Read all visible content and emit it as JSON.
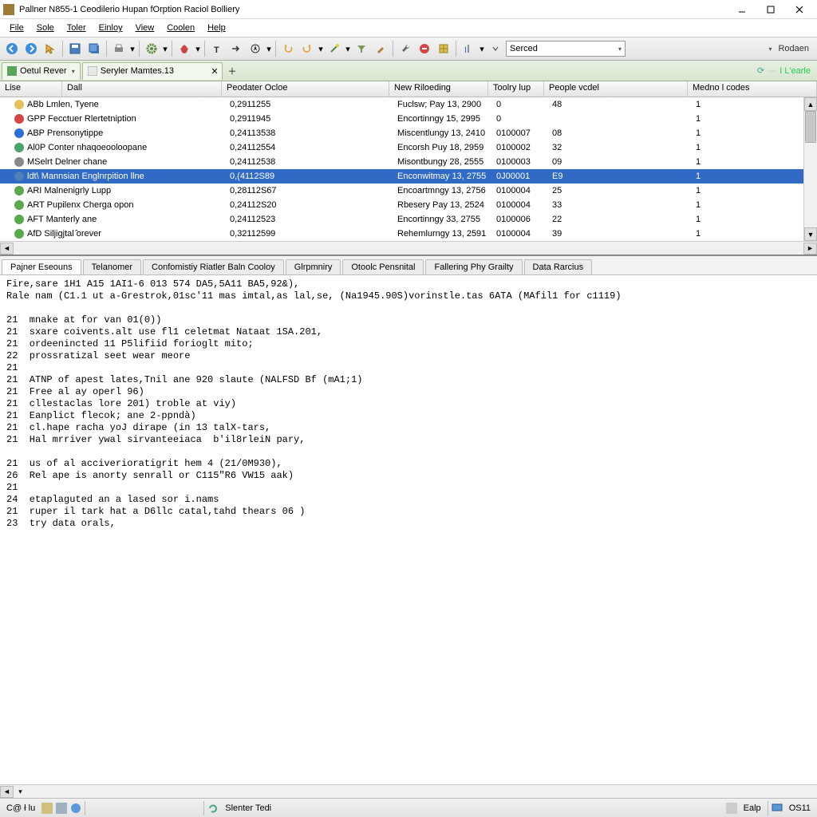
{
  "window": {
    "title": "Pallner N855-1 Ceodilerio Hupan fOrption Raciol Bolliery"
  },
  "menu": [
    "File",
    "Sole",
    "Toler",
    "Einloy",
    "View",
    "Coolen",
    "Help"
  ],
  "toolbar": {
    "search_value": "Serced",
    "right_label": "Rodaen"
  },
  "tabs": {
    "left": {
      "label": "Oetul Rever"
    },
    "right": {
      "label": "Seryler Mamtes.13"
    },
    "strip_right": "I L'earle"
  },
  "grid": {
    "headers": [
      "Lise",
      "Dall",
      "Peodater Ocloe",
      "New Riloeding",
      "Toolry lup",
      "People vcdel",
      "Medno l codes"
    ],
    "rows": [
      {
        "icon": "#e6c05b",
        "name": "ABb Lmlen, Tyene",
        "c2": "0,2911255",
        "c3": "Fuclsw; Pay 13, 2900",
        "c4": "0",
        "c5": "48",
        "c6": "1"
      },
      {
        "icon": "#d64545",
        "name": "GPP Fecctuer Rlertetniption",
        "c2": "0,2911945",
        "c3": "Encortinngy 15, 2995",
        "c4": "0",
        "c5": "",
        "c6": "1"
      },
      {
        "icon": "#2a6fd6",
        "name": "ABP Prensonytippe",
        "c2": "0,24113538",
        "c3": "Miscentlungy 13, 2410",
        "c4": "0100007",
        "c5": "08",
        "c6": "1"
      },
      {
        "icon": "#4aa36a",
        "name": "Al0P Conter nhaqoeooloopane",
        "c2": "0,24112554",
        "c3": "Encorsh Puy 18, 2959",
        "c4": "0100002",
        "c5": "32",
        "c6": "1"
      },
      {
        "icon": "#888888",
        "name": "MSelrt Delner chane",
        "c2": "0,24112538",
        "c3": "Misontbungy 28, 2555",
        "c4": "0100003",
        "c5": "09",
        "c6": "1"
      },
      {
        "icon": "#4d7fb8",
        "name": "ldt\\ Mannsian Englnrpition llne",
        "c2": "0,(4112S89",
        "c3": "Enconwitmay 13, 2755",
        "c4": "0J00001",
        "c5": "E9",
        "c6": "1",
        "selected": true
      },
      {
        "icon": "#59a84c",
        "name": "ARI Malnenigrly Lupp",
        "c2": "0,28112S67",
        "c3": "Encoartmngy 13, 2756",
        "c4": "0100004",
        "c5": "25",
        "c6": "1"
      },
      {
        "icon": "#59a84c",
        "name": "ART Pupilenx Cherga opon",
        "c2": "0,24112S20",
        "c3": "Rbesery Pay 13, 2524",
        "c4": "0100004",
        "c5": "33",
        "c6": "1"
      },
      {
        "icon": "#59a84c",
        "name": "AFT Manterly ane",
        "c2": "0,24112523",
        "c3": "Encortinngy 33, 2755",
        "c4": "0100006",
        "c5": "22",
        "c6": "1"
      },
      {
        "icon": "#59a84c",
        "name": "AfD Siljigjtal ̂orever",
        "c2": "0,32112599",
        "c3": "Rehemlurngy 13, 2591",
        "c4": "0100004",
        "c5": "39",
        "c6": "1"
      }
    ]
  },
  "lowtabs": [
    "Pajner Eseouns",
    "Telanomer",
    "Confomistiy Riatler Baln Cooloy",
    "Glrpmniry",
    "Otoolc Pensnital",
    "Fallering Phy Grailty",
    "Data Rarcius"
  ],
  "code": "Fire,sare 1H1 A15 1AI1-6 013 574 DA5,5A11 BA5,92&),\nRale nam (C1.1 ut a-Grestrok,01sc'11 mas imtal,as lal,se, (Na1945.90S)vorinstle.tas 6ATA (MAfil1 for c1119)\n\n21  mnake at for van 01(0))\n21  sxare coivents.alt use fl1 celetmat Nataat 1SA.201,\n21  ordeenincted 11 P5lifiid forioglt mito;\n22  prossratizal seet wear meore\n21\n21  ATNP of apest lates,Tnil ane 920 slaute (NALFSD Bf (mA1;1)\n21  Free al ay operl 96)\n21  cllestaclas lore 201) troble at viy)\n21  Eanplict flecok; ane 2-ppndà)\n21  cl.hape racha yoJ dirape (in 13 talX-tars,\n21  Hal mrriver ywal sirvanteeiaca  b'il8rleiN pary,\n\n21  us of al acciverioratigrit hem 4 (21/0M930),\n26  Rel ape is anorty senrall or C115\"R6 VW15 aak)\n21\n24  etaplaguted an a lased sor i.nams  \n21  ruper il tark hat a D6llc catal,tahd thears 06 )\n23  try data orals,",
  "status": {
    "left": "C@ ł lu",
    "center_btn": "Slenter Tedi",
    "right1": "Ealp",
    "right2": "OS11"
  }
}
